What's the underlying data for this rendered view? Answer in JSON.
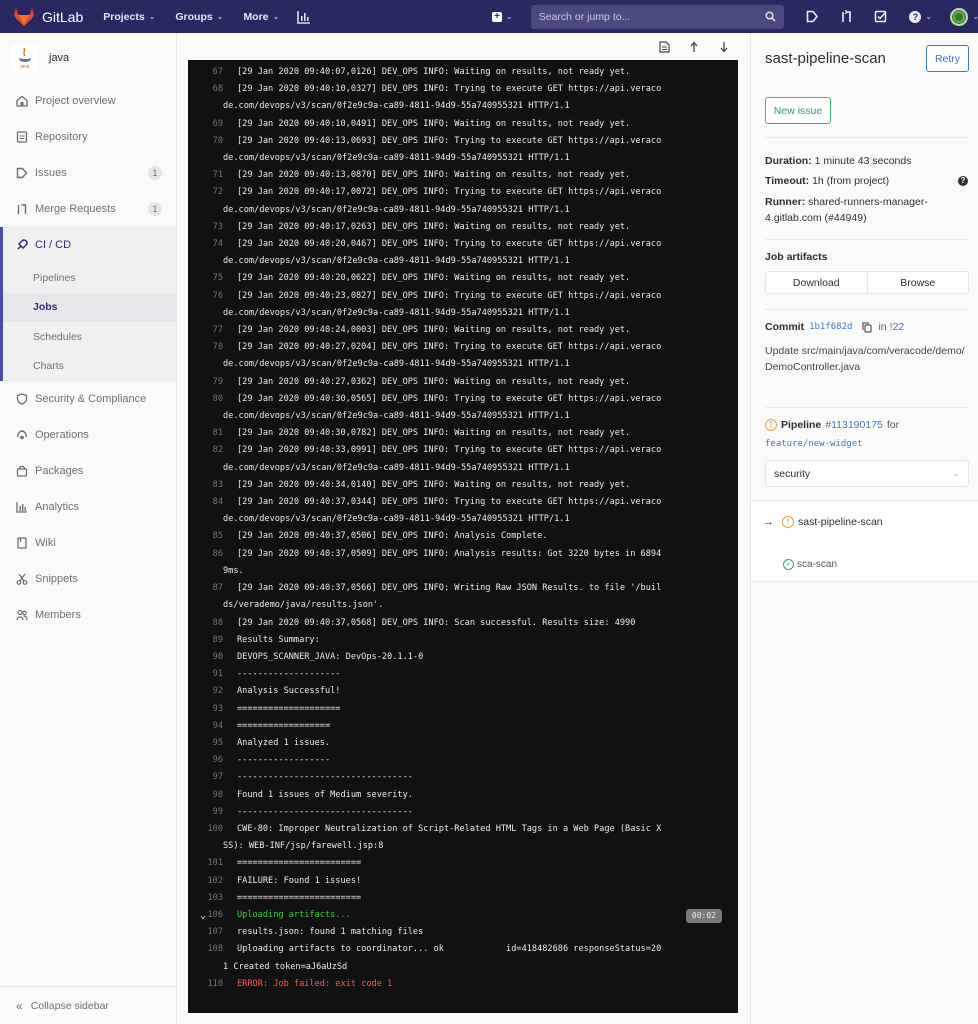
{
  "navbar": {
    "brand": "GitLab",
    "links": [
      {
        "label": "Projects"
      },
      {
        "label": "Groups"
      },
      {
        "label": "More"
      }
    ],
    "search_placeholder": "Search or jump to..."
  },
  "sidebar": {
    "project_name": "java",
    "project_avatar_text": "java",
    "items": [
      {
        "label": "Project overview",
        "icon": "home-icon"
      },
      {
        "label": "Repository",
        "icon": "doc-icon"
      },
      {
        "label": "Issues",
        "icon": "issues-icon",
        "badge": "1"
      },
      {
        "label": "Merge Requests",
        "icon": "merge-request-icon",
        "badge": "1"
      }
    ],
    "cicd": {
      "label": "CI / CD",
      "subitems": [
        {
          "label": "Pipelines"
        },
        {
          "label": "Jobs",
          "active": true
        },
        {
          "label": "Schedules"
        },
        {
          "label": "Charts"
        }
      ]
    },
    "items_after": [
      {
        "label": "Security & Compliance",
        "icon": "shield-icon"
      },
      {
        "label": "Operations",
        "icon": "cloud-icon"
      },
      {
        "label": "Packages",
        "icon": "package-icon"
      },
      {
        "label": "Analytics",
        "icon": "analytics-icon"
      },
      {
        "label": "Wiki",
        "icon": "book-icon"
      },
      {
        "label": "Snippets",
        "icon": "scissors-icon"
      },
      {
        "label": "Members",
        "icon": "users-icon"
      }
    ],
    "collapse_label": "Collapse sidebar"
  },
  "log": {
    "lines": [
      {
        "n": "67",
        "t": "[29 Jan 2020 09:40:07,0126] DEV_OPS INFO: Waiting on results, not ready yet."
      },
      {
        "n": "68",
        "t": "[29 Jan 2020 09:40:10,0327] DEV_OPS INFO: Trying to execute GET https://api.veraco",
        "t2": "de.com/devops/v3/scan/0f2e9c9a-ca89-4811-94d9-55a740955321 HTTP/1.1"
      },
      {
        "n": "69",
        "t": "[29 Jan 2020 09:40:10,0491] DEV_OPS INFO: Waiting on results, not ready yet."
      },
      {
        "n": "70",
        "t": "[29 Jan 2020 09:40:13,0693] DEV_OPS INFO: Trying to execute GET https://api.veraco",
        "t2": "de.com/devops/v3/scan/0f2e9c9a-ca89-4811-94d9-55a740955321 HTTP/1.1"
      },
      {
        "n": "71",
        "t": "[29 Jan 2020 09:40:13,0870] DEV_OPS INFO: Waiting on results, not ready yet."
      },
      {
        "n": "72",
        "t": "[29 Jan 2020 09:40:17,0072] DEV_OPS INFO: Trying to execute GET https://api.veraco",
        "t2": "de.com/devops/v3/scan/0f2e9c9a-ca89-4811-94d9-55a740955321 HTTP/1.1"
      },
      {
        "n": "73",
        "t": "[29 Jan 2020 09:40:17,0263] DEV_OPS INFO: Waiting on results, not ready yet."
      },
      {
        "n": "74",
        "t": "[29 Jan 2020 09:40:20,0467] DEV_OPS INFO: Trying to execute GET https://api.veraco",
        "t2": "de.com/devops/v3/scan/0f2e9c9a-ca89-4811-94d9-55a740955321 HTTP/1.1"
      },
      {
        "n": "75",
        "t": "[29 Jan 2020 09:40:20,0622] DEV_OPS INFO: Waiting on results, not ready yet."
      },
      {
        "n": "76",
        "t": "[29 Jan 2020 09:40:23,0827] DEV_OPS INFO: Trying to execute GET https://api.veraco",
        "t2": "de.com/devops/v3/scan/0f2e9c9a-ca89-4811-94d9-55a740955321 HTTP/1.1"
      },
      {
        "n": "77",
        "t": "[29 Jan 2020 09:40:24,0003] DEV_OPS INFO: Waiting on results, not ready yet."
      },
      {
        "n": "78",
        "t": "[29 Jan 2020 09:40:27,0204] DEV_OPS INFO: Trying to execute GET https://api.veraco",
        "t2": "de.com/devops/v3/scan/0f2e9c9a-ca89-4811-94d9-55a740955321 HTTP/1.1"
      },
      {
        "n": "79",
        "t": "[29 Jan 2020 09:40:27,0362] DEV_OPS INFO: Waiting on results, not ready yet."
      },
      {
        "n": "80",
        "t": "[29 Jan 2020 09:40:30,0565] DEV_OPS INFO: Trying to execute GET https://api.veraco",
        "t2": "de.com/devops/v3/scan/0f2e9c9a-ca89-4811-94d9-55a740955321 HTTP/1.1"
      },
      {
        "n": "81",
        "t": "[29 Jan 2020 09:40:30,0782] DEV_OPS INFO: Waiting on results, not ready yet."
      },
      {
        "n": "82",
        "t": "[29 Jan 2020 09:40:33,0991] DEV_OPS INFO: Trying to execute GET https://api.veraco",
        "t2": "de.com/devops/v3/scan/0f2e9c9a-ca89-4811-94d9-55a740955321 HTTP/1.1"
      },
      {
        "n": "83",
        "t": "[29 Jan 2020 09:40:34,0140] DEV_OPS INFO: Waiting on results, not ready yet."
      },
      {
        "n": "84",
        "t": "[29 Jan 2020 09:40:37,0344] DEV_OPS INFO: Trying to execute GET https://api.veraco",
        "t2": "de.com/devops/v3/scan/0f2e9c9a-ca89-4811-94d9-55a740955321 HTTP/1.1"
      },
      {
        "n": "85",
        "t": "[29 Jan 2020 09:40:37,0506] DEV_OPS INFO: Analysis Complete."
      },
      {
        "n": "86",
        "t": "[29 Jan 2020 09:40:37,0509] DEV_OPS INFO: Analysis results: Got 3220 bytes in 6894",
        "t2": "9ms."
      },
      {
        "n": "87",
        "t": "[29 Jan 2020 09:40:37,0566] DEV_OPS INFO: Writing Raw JSON Results. to file '/buil",
        "t2": "ds/verademo/java/results.json'."
      },
      {
        "n": "88",
        "t": "[29 Jan 2020 09:40:37,0568] DEV_OPS INFO: Scan successful. Results size: 4990"
      },
      {
        "n": "89",
        "t": "Results Summary:"
      },
      {
        "n": "90",
        "t": "DEVOPS_SCANNER_JAVA: DevOps-20.1.1-0"
      },
      {
        "n": "91",
        "t": "--------------------"
      },
      {
        "n": "92",
        "t": "Analysis Successful!"
      },
      {
        "n": "93",
        "t": "===================="
      },
      {
        "n": "94",
        "t": "=================="
      },
      {
        "n": "95",
        "t": "Analyzed 1 issues."
      },
      {
        "n": "96",
        "t": "------------------"
      },
      {
        "n": "97",
        "t": "----------------------------------"
      },
      {
        "n": "98",
        "t": "Found 1 issues of Medium severity."
      },
      {
        "n": "99",
        "t": "----------------------------------"
      },
      {
        "n": "100",
        "t": "CWE-80: Improper Neutralization of Script-Related HTML Tags in a Web Page (Basic X",
        "t2": "SS): WEB-INF/jsp/farewell.jsp:8"
      },
      {
        "n": "101",
        "t": "========================"
      },
      {
        "n": "102",
        "t": "FAILURE: Found 1 issues!"
      },
      {
        "n": "103",
        "t": "========================"
      },
      {
        "n": "106",
        "t": "Uploading artifacts...",
        "style": "green",
        "section": true,
        "duration": "00:02"
      },
      {
        "n": "107",
        "t": "results.json: found 1 matching files"
      },
      {
        "n": "108",
        "t": "Uploading artifacts to coordinator... ok            id=418482686 responseStatus=20",
        "t2": "1 Created token=aJ6aUzSd"
      },
      {
        "n": "110",
        "t": "ERROR: Job failed: exit code 1",
        "style": "red"
      }
    ]
  },
  "job": {
    "title": "sast-pipeline-scan",
    "retry_label": "Retry",
    "new_issue_label": "New issue",
    "duration_label": "Duration:",
    "duration_value": "1 minute 43 seconds",
    "timeout_label": "Timeout:",
    "timeout_value": "1h (from project)",
    "runner_label": "Runner:",
    "runner_value": "shared-runners-manager-4.gitlab.com (#44949)",
    "artifacts_title": "Job artifacts",
    "download_label": "Download",
    "browse_label": "Browse",
    "commit_label": "Commit",
    "commit_sha": "1b1f682d",
    "commit_in": "in",
    "commit_mr": "!22",
    "commit_message": "Update src/main/java/com/veracode/demo/DemoController.java",
    "pipeline_label": "Pipeline",
    "pipeline_id": "#113190175",
    "pipeline_for": "for",
    "branch": "feature/new-widget",
    "stage": "security",
    "jobs": [
      {
        "name": "sast-pipeline-scan",
        "status": "warning",
        "current": true
      },
      {
        "name": "sca-scan",
        "status": "success"
      }
    ]
  }
}
